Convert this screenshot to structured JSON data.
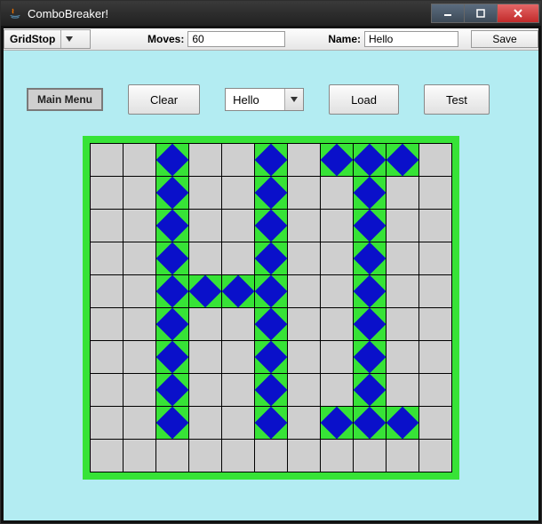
{
  "window": {
    "title": "ComboBreaker!"
  },
  "toolbar": {
    "mode_combo": "GridStop",
    "moves_label": "Moves:",
    "moves_value": "60",
    "name_label": "Name:",
    "name_value": "Hello",
    "save_label": "Save"
  },
  "controls": {
    "main_menu": "Main Menu",
    "clear": "Clear",
    "selector": "Hello",
    "load": "Load",
    "test": "Test"
  },
  "grid": {
    "cols": 11,
    "rows": 10,
    "filled": [
      [
        0,
        2
      ],
      [
        0,
        5
      ],
      [
        0,
        7
      ],
      [
        0,
        8
      ],
      [
        0,
        9
      ],
      [
        1,
        2
      ],
      [
        1,
        5
      ],
      [
        1,
        8
      ],
      [
        2,
        2
      ],
      [
        2,
        5
      ],
      [
        2,
        8
      ],
      [
        3,
        2
      ],
      [
        3,
        5
      ],
      [
        3,
        8
      ],
      [
        4,
        2
      ],
      [
        4,
        3
      ],
      [
        4,
        4
      ],
      [
        4,
        5
      ],
      [
        4,
        8
      ],
      [
        5,
        2
      ],
      [
        5,
        5
      ],
      [
        5,
        8
      ],
      [
        6,
        2
      ],
      [
        6,
        5
      ],
      [
        6,
        8
      ],
      [
        7,
        2
      ],
      [
        7,
        5
      ],
      [
        7,
        8
      ],
      [
        8,
        2
      ],
      [
        8,
        5
      ],
      [
        8,
        7
      ],
      [
        8,
        8
      ],
      [
        8,
        9
      ]
    ]
  }
}
